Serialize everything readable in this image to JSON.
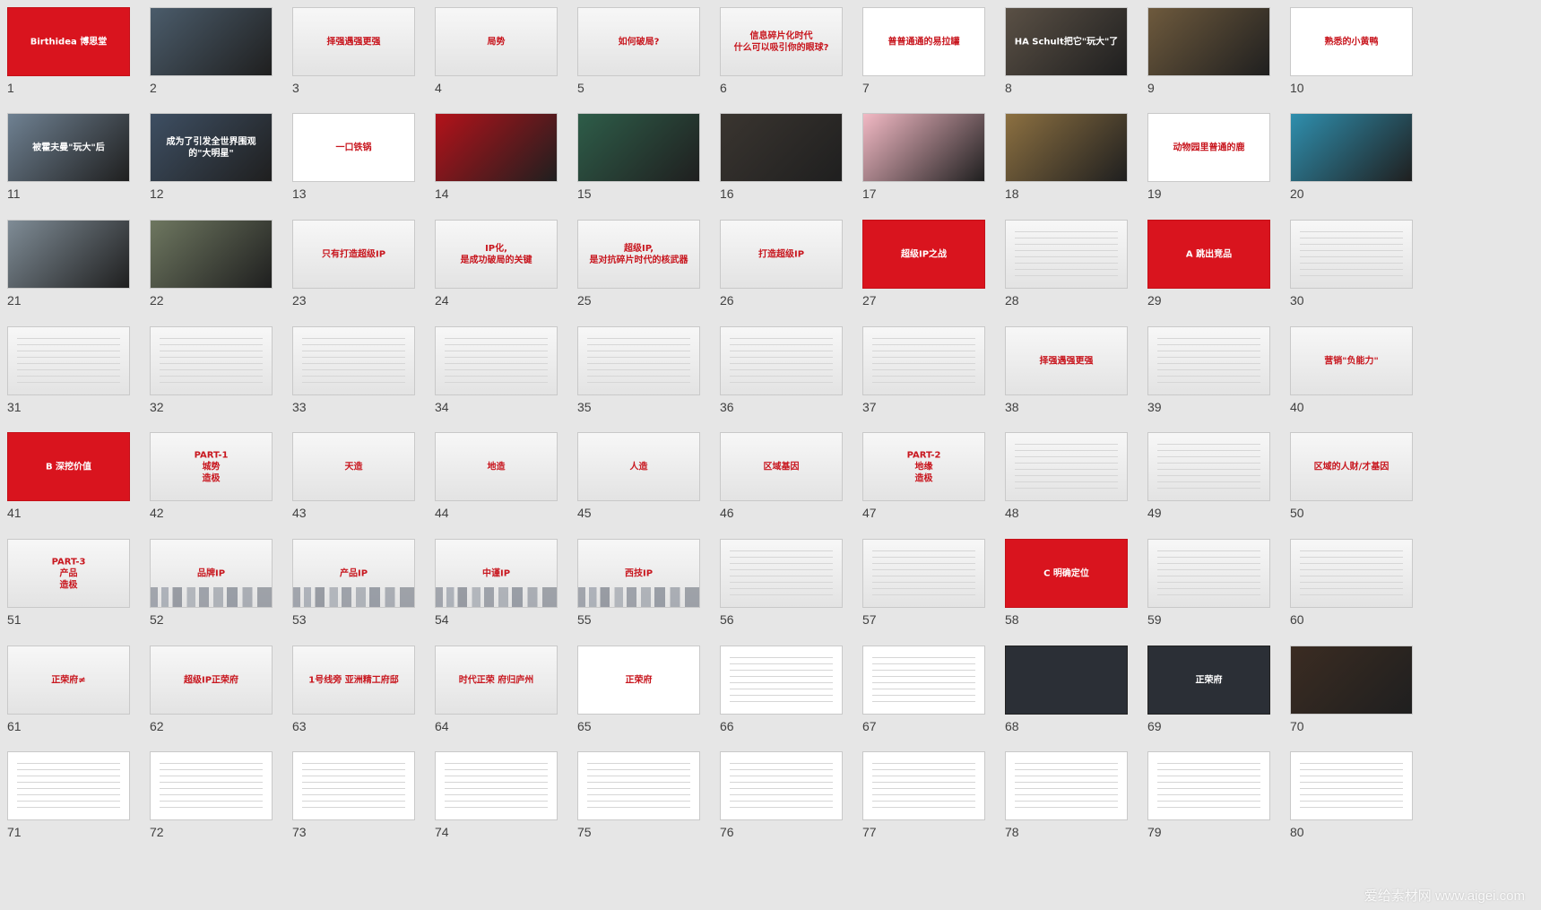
{
  "watermark": "爱给素材网 www.aigei.com",
  "slides": [
    {
      "number": "1",
      "text": "Birthidea 博思堂",
      "style": "red"
    },
    {
      "number": "2",
      "text": "",
      "style": "photo",
      "color": "#4b5c6b"
    },
    {
      "number": "3",
      "text": "择强遇强更强",
      "style": "grad"
    },
    {
      "number": "4",
      "text": "局势",
      "style": "grad"
    },
    {
      "number": "5",
      "text": "如何破局?",
      "style": "grad"
    },
    {
      "number": "6",
      "text": "信息碎片化时代\n什么可以吸引你的眼球?",
      "style": "grad"
    },
    {
      "number": "7",
      "text": "普普通通的易拉罐",
      "style": "white"
    },
    {
      "number": "8",
      "text": "HA Schult把它\"玩大\"了",
      "style": "photo",
      "color": "#5a5045"
    },
    {
      "number": "9",
      "text": "",
      "style": "photo",
      "color": "#6e5a3d"
    },
    {
      "number": "10",
      "text": "熟悉的小黄鸭",
      "style": "white"
    },
    {
      "number": "11",
      "text": "被霍夫曼\"玩大\"后",
      "style": "photo",
      "color": "#6f8192"
    },
    {
      "number": "12",
      "text": "成为了引发全世界围观的\"大明星\"",
      "style": "photo",
      "color": "#3e4f63"
    },
    {
      "number": "13",
      "text": "一口铁锅",
      "style": "white"
    },
    {
      "number": "14",
      "text": "",
      "style": "photo",
      "color": "#b3121a"
    },
    {
      "number": "15",
      "text": "",
      "style": "photo",
      "color": "#2e5d49"
    },
    {
      "number": "16",
      "text": "",
      "style": "photo",
      "color": "#3a3530"
    },
    {
      "number": "17",
      "text": "",
      "style": "photo",
      "color": "#f2b9c4"
    },
    {
      "number": "18",
      "text": "",
      "style": "photo",
      "color": "#8c7041"
    },
    {
      "number": "19",
      "text": "动物园里普通的鹿",
      "style": "white"
    },
    {
      "number": "20",
      "text": "",
      "style": "photo",
      "color": "#2f8fae"
    },
    {
      "number": "21",
      "text": "",
      "style": "photo",
      "color": "#7f8c96"
    },
    {
      "number": "22",
      "text": "",
      "style": "photo",
      "color": "#6e7760"
    },
    {
      "number": "23",
      "text": "只有打造超级IP",
      "style": "grad"
    },
    {
      "number": "24",
      "text": "IP化,\n是成功破局的关键",
      "style": "grad"
    },
    {
      "number": "25",
      "text": "超级IP,\n是对抗碎片时代的核武器",
      "style": "grad"
    },
    {
      "number": "26",
      "text": "打造超级IP",
      "style": "grad"
    },
    {
      "number": "27",
      "text": "超级IP之战",
      "style": "red"
    },
    {
      "number": "28",
      "text": "",
      "style": "grad"
    },
    {
      "number": "29",
      "text": "A 跳出竞品",
      "style": "red"
    },
    {
      "number": "30",
      "text": "",
      "style": "grad"
    },
    {
      "number": "31",
      "text": "",
      "style": "grad"
    },
    {
      "number": "32",
      "text": "",
      "style": "grad"
    },
    {
      "number": "33",
      "text": "",
      "style": "grad"
    },
    {
      "number": "34",
      "text": "",
      "style": "grad"
    },
    {
      "number": "35",
      "text": "",
      "style": "grad"
    },
    {
      "number": "36",
      "text": "",
      "style": "grad"
    },
    {
      "number": "37",
      "text": "",
      "style": "grad"
    },
    {
      "number": "38",
      "text": "择强遇强更强",
      "style": "grad"
    },
    {
      "number": "39",
      "text": "",
      "style": "grad"
    },
    {
      "number": "40",
      "text": "营销\"负能力\"",
      "style": "grad"
    },
    {
      "number": "41",
      "text": "B 深挖价值",
      "style": "red"
    },
    {
      "number": "42",
      "text": "PART-1\n城势\n造极",
      "style": "grad"
    },
    {
      "number": "43",
      "text": "天造",
      "style": "grad"
    },
    {
      "number": "44",
      "text": "地造",
      "style": "grad"
    },
    {
      "number": "45",
      "text": "人造",
      "style": "grad"
    },
    {
      "number": "46",
      "text": "区域基因",
      "style": "grad"
    },
    {
      "number": "47",
      "text": "PART-2\n地缘\n造极",
      "style": "grad"
    },
    {
      "number": "48",
      "text": "",
      "style": "grad"
    },
    {
      "number": "49",
      "text": "",
      "style": "grad"
    },
    {
      "number": "50",
      "text": "区域的人财/才基因",
      "style": "grad"
    },
    {
      "number": "51",
      "text": "PART-3\n产品\n造极",
      "style": "grad"
    },
    {
      "number": "52",
      "text": "品牌IP",
      "style": "grad"
    },
    {
      "number": "53",
      "text": "产品IP",
      "style": "grad"
    },
    {
      "number": "54",
      "text": "中谨IP",
      "style": "grad"
    },
    {
      "number": "55",
      "text": "西技IP",
      "style": "grad"
    },
    {
      "number": "56",
      "text": "",
      "style": "grad"
    },
    {
      "number": "57",
      "text": "",
      "style": "grad"
    },
    {
      "number": "58",
      "text": "C 明确定位",
      "style": "red"
    },
    {
      "number": "59",
      "text": "",
      "style": "grad"
    },
    {
      "number": "60",
      "text": "",
      "style": "grad"
    },
    {
      "number": "61",
      "text": "正荣府≠",
      "style": "grad"
    },
    {
      "number": "62",
      "text": "超级IP正荣府",
      "style": "grad"
    },
    {
      "number": "63",
      "text": "1号线旁 亚洲精工府邸",
      "style": "grad"
    },
    {
      "number": "64",
      "text": "时代正荣 府归庐州",
      "style": "grad"
    },
    {
      "number": "65",
      "text": "正荣府",
      "style": "white"
    },
    {
      "number": "66",
      "text": "",
      "style": "white"
    },
    {
      "number": "67",
      "text": "",
      "style": "white"
    },
    {
      "number": "68",
      "text": "",
      "style": "dark"
    },
    {
      "number": "69",
      "text": "正荣府",
      "style": "dark"
    },
    {
      "number": "70",
      "text": "",
      "style": "photo",
      "color": "#3b2c22"
    },
    {
      "number": "71",
      "text": "",
      "style": "white"
    },
    {
      "number": "72",
      "text": "",
      "style": "white"
    },
    {
      "number": "73",
      "text": "",
      "style": "white"
    },
    {
      "number": "74",
      "text": "",
      "style": "white"
    },
    {
      "number": "75",
      "text": "",
      "style": "white"
    },
    {
      "number": "76",
      "text": "",
      "style": "white"
    },
    {
      "number": "77",
      "text": "",
      "style": "white"
    },
    {
      "number": "78",
      "text": "",
      "style": "white"
    },
    {
      "number": "79",
      "text": "",
      "style": "white"
    },
    {
      "number": "80",
      "text": "",
      "style": "white"
    }
  ]
}
